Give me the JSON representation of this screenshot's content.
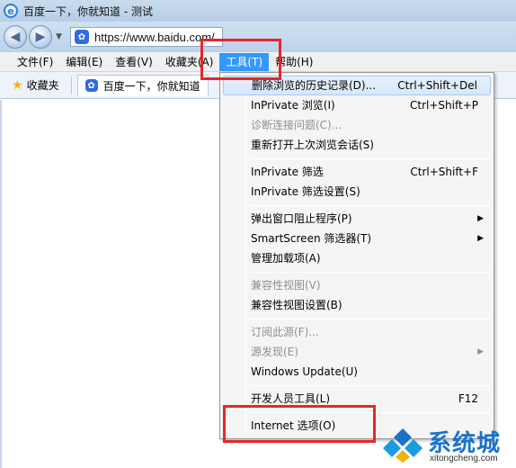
{
  "window": {
    "title": "百度一下，你就知道 - 测试",
    "icon": "ie-logo-icon"
  },
  "address": {
    "url": "https://www.baidu.com/",
    "site_icon": "baidu-paw-icon"
  },
  "menubar": {
    "items": [
      "文件(F)",
      "编辑(E)",
      "查看(V)",
      "收藏夹(A)",
      "工具(T)",
      "帮助(H)"
    ],
    "active_index": 4,
    "highlight_color": "#3399ff"
  },
  "favbar": {
    "favorites_label": "收藏夹",
    "tab_title": "百度一下，你就知道"
  },
  "tools_menu": {
    "items": [
      {
        "label": "删除浏览的历史记录(D)...",
        "shortcut": "Ctrl+Shift+Del",
        "enabled": true,
        "highlighted": true
      },
      {
        "label": "InPrivate 浏览(I)",
        "shortcut": "Ctrl+Shift+P",
        "enabled": true
      },
      {
        "label": "诊断连接问题(C)...",
        "shortcut": "",
        "enabled": false
      },
      {
        "label": "重新打开上次浏览会话(S)",
        "shortcut": "",
        "enabled": true
      },
      {
        "label": "InPrivate 筛选",
        "shortcut": "Ctrl+Shift+F",
        "enabled": true
      },
      {
        "label": "InPrivate 筛选设置(S)",
        "shortcut": "",
        "enabled": true
      },
      {
        "label": "弹出窗口阻止程序(P)",
        "shortcut": "",
        "enabled": true,
        "submenu": true
      },
      {
        "label": "SmartScreen 筛选器(T)",
        "shortcut": "",
        "enabled": true,
        "submenu": true
      },
      {
        "label": "管理加载项(A)",
        "shortcut": "",
        "enabled": true
      },
      {
        "label": "兼容性视图(V)",
        "shortcut": "",
        "enabled": false
      },
      {
        "label": "兼容性视图设置(B)",
        "shortcut": "",
        "enabled": true
      },
      {
        "label": "订阅此源(F)...",
        "shortcut": "",
        "enabled": false
      },
      {
        "label": "源发现(E)",
        "shortcut": "",
        "enabled": false,
        "submenu": true
      },
      {
        "label": "Windows Update(U)",
        "shortcut": "",
        "enabled": true
      },
      {
        "label": "开发人员工具(L)",
        "shortcut": "F12",
        "enabled": true
      },
      {
        "label": "Internet 选项(O)",
        "shortcut": "",
        "enabled": true
      }
    ]
  },
  "annotations": {
    "color": "#e8262a"
  },
  "watermark": {
    "brand": "系统城",
    "site": "xitongcheng.com"
  }
}
